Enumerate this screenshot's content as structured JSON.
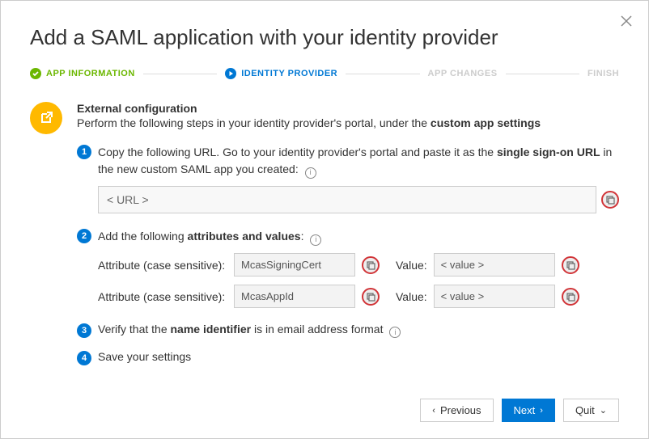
{
  "dialog": {
    "title": "Add a SAML application with your identity provider"
  },
  "stepper": {
    "steps": [
      {
        "label": "APP INFORMATION",
        "state": "done"
      },
      {
        "label": "IDENTITY PROVIDER",
        "state": "active"
      },
      {
        "label": "APP CHANGES",
        "state": "pending"
      },
      {
        "label": "FINISH",
        "state": "pending"
      }
    ]
  },
  "section": {
    "title": "External configuration",
    "desc_pre": "Perform the following steps in your identity provider's portal, under the ",
    "desc_bold": "custom app settings"
  },
  "steps": {
    "s1": {
      "num": "1",
      "pre": "Copy the following URL. Go to your identity provider's portal and paste it as the ",
      "bold": "single sign-on URL",
      "post": " in the new custom SAML app you created:",
      "url": "< URL >"
    },
    "s2": {
      "num": "2",
      "pre": "Add the following ",
      "bold": "attributes and values",
      "post": ":",
      "attr_label": "Attribute (case sensitive):",
      "value_label": "Value:",
      "rows": [
        {
          "attr": "McasSigningCert",
          "value": "< value >"
        },
        {
          "attr": "McasAppId",
          "value": "< value >"
        }
      ]
    },
    "s3": {
      "num": "3",
      "pre": "Verify that the ",
      "bold": "name identifier",
      "post": " is in email address format"
    },
    "s4": {
      "num": "4",
      "text": "Save your settings"
    }
  },
  "footer": {
    "previous": "Previous",
    "next": "Next",
    "quit": "Quit"
  }
}
